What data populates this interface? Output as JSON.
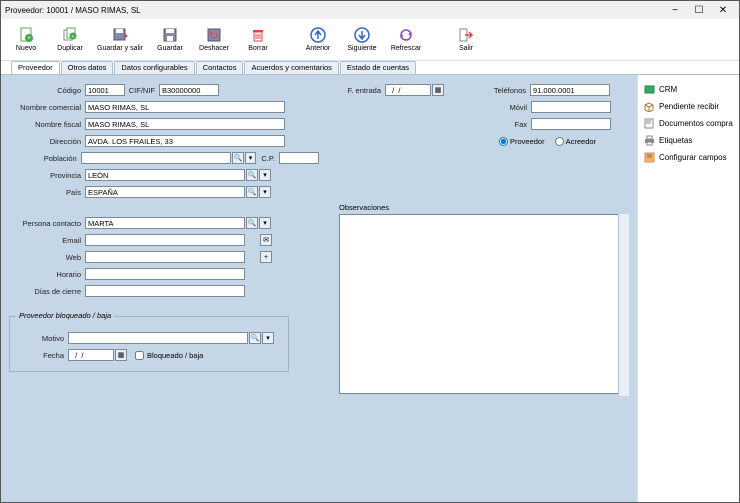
{
  "window": {
    "title": "Proveedor: 10001    / MASO RIMAS, SL"
  },
  "toolbar": {
    "nuevo": "Nuevo",
    "duplicar": "Duplicar",
    "guardar_salir": "Guardar y salir",
    "guardar": "Guardar",
    "deshacer": "Deshacer",
    "borrar": "Borrar",
    "anterior": "Anterior",
    "siguiente": "Siguiente",
    "refrescar": "Refrescar",
    "salir": "Salir"
  },
  "tabs": [
    "Proveedor",
    "Otros datos",
    "Datos configurables",
    "Contactos",
    "Acuerdos y comentarios",
    "Estado de cuentas"
  ],
  "labels": {
    "codigo": "Código",
    "cifnif": "CIF/NIF",
    "fentrada": "F. entrada",
    "nombre_comercial": "Nombre comercial",
    "nombre_fiscal": "Nombre fiscal",
    "direccion": "Dirección",
    "poblacion": "Población",
    "cp": "C.P.",
    "provincia": "Provincia",
    "pais": "País",
    "telefonos": "Teléfonos",
    "movil": "Móvil",
    "fax": "Fax",
    "proveedor": "Proveedor",
    "acreedor": "Acreedor",
    "persona_contacto": "Persona contacto",
    "email": "Email",
    "web": "Web",
    "horario": "Horario",
    "dias_cierre": "Días de cierre",
    "observaciones": "Observaciones",
    "motivo": "Motivo",
    "fecha": "Fecha",
    "bloqueado": "Bloqueado / baja",
    "grupo_bloq": "Proveedor bloqueado / baja"
  },
  "values": {
    "codigo": "10001",
    "cifnif": "B30000000",
    "fentrada": "  /  /",
    "nombre_comercial": "MASO RIMAS, SL",
    "nombre_fiscal": "MASO RIMAS, SL",
    "direccion": "AVDA. LOS FRAILES, 33",
    "poblacion": "",
    "cp": "",
    "provincia": "LEÓN",
    "pais": "ESPAÑA",
    "telefonos": "91.000.0001",
    "movil": "",
    "fax": "",
    "persona_contacto": "MARTA",
    "email": "",
    "web": "",
    "horario": "",
    "dias_cierre": "",
    "observaciones": "",
    "motivo": "",
    "fecha": "  /  /"
  },
  "side": {
    "crm": "CRM",
    "pendiente": "Pendiente recibir",
    "documentos": "Documentos compra",
    "etiquetas": "Etiquetas",
    "configurar": "Configurar campos"
  }
}
